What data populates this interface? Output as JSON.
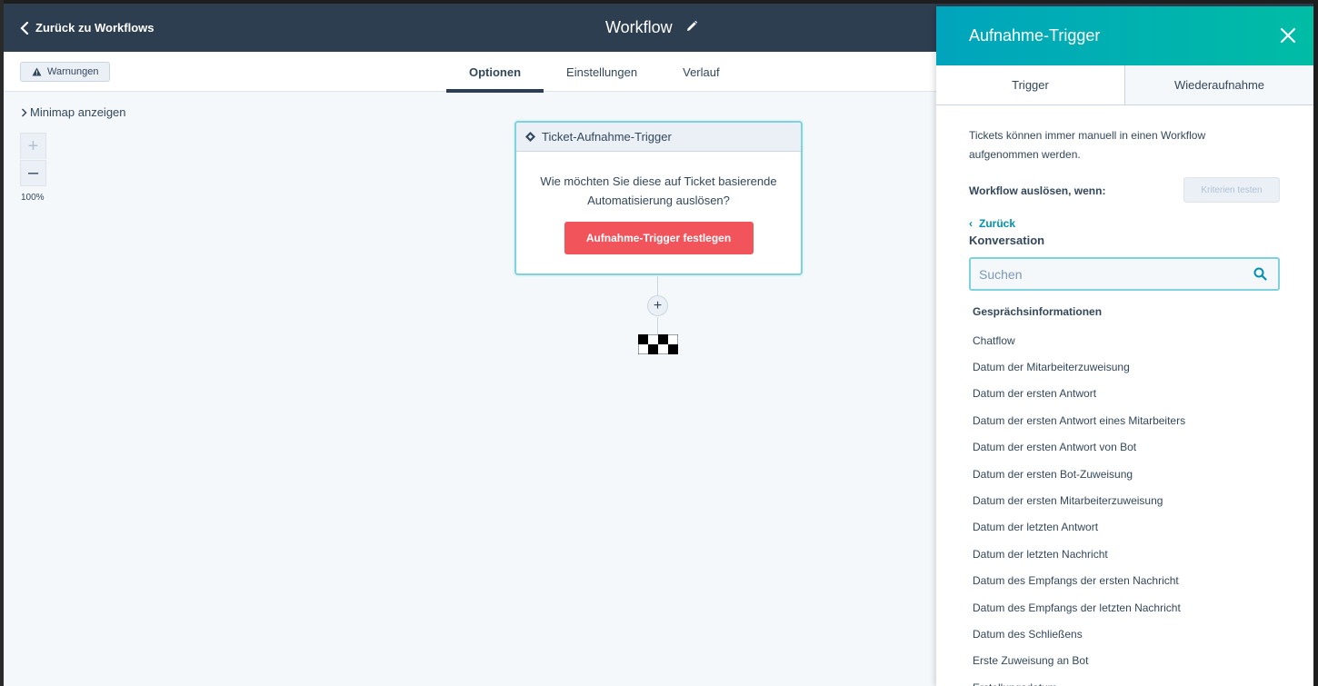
{
  "header": {
    "back_label": "Zurück zu Workflows",
    "title": "Workflow"
  },
  "subbar": {
    "warnings_label": "Warnungen",
    "tabs": [
      "Optionen",
      "Einstellungen",
      "Verlauf"
    ],
    "active_tab": "Optionen"
  },
  "canvas": {
    "minimap_label": "Minimap anzeigen",
    "zoom_in": "+",
    "zoom_out": "–",
    "zoom_level": "100%",
    "trigger_card": {
      "title": "Ticket-Aufnahme-Trigger",
      "question": "Wie möchten Sie diese auf Ticket basierende Automatisierung auslösen?",
      "button_label": "Aufnahme-Trigger festlegen"
    },
    "add_step": "+"
  },
  "panel": {
    "title": "Aufnahme-Trigger",
    "tabs": [
      "Trigger",
      "Wiederaufnahme"
    ],
    "active_tab": "Trigger",
    "info_text": "Tickets können immer manuell in einen Workflow aufgenommen werden.",
    "trigger_when_label": "Workflow auslösen, wenn:",
    "test_criteria_label": "Kriterien testen",
    "back_label": "Zurück",
    "section_title": "Konversation",
    "search_placeholder": "Suchen",
    "group_title": "Gesprächsinformationen",
    "items": [
      "Chatflow",
      "Datum der Mitarbeiterzuweisung",
      "Datum der ersten Antwort",
      "Datum der ersten Antwort eines Mitarbeiters",
      "Datum der ersten Antwort von Bot",
      "Datum der ersten Bot-Zuweisung",
      "Datum der ersten Mitarbeiterzuweisung",
      "Datum der letzten Antwort",
      "Datum der letzten Nachricht",
      "Datum des Empfangs der ersten Nachricht",
      "Datum des Empfangs der letzten Nachricht",
      "Datum des Schließens",
      "Erste Zuweisung an Bot",
      "Erstellungsdatum"
    ]
  },
  "colors": {
    "header_bg": "#2d3e50",
    "accent_teal": "#00a4bd",
    "cta_coral": "#f2545b",
    "link": "#0091ae"
  }
}
